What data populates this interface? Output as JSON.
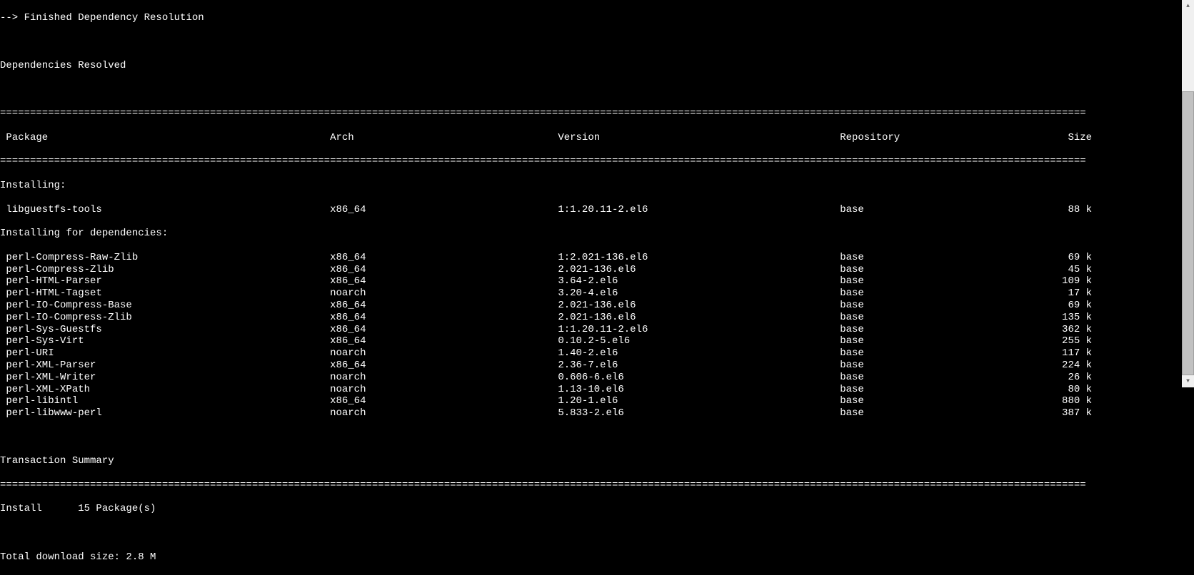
{
  "messages": {
    "finished_resolution": "--> Finished Dependency Resolution",
    "dependencies_resolved": "Dependencies Resolved",
    "installing": "Installing:",
    "installing_deps": "Installing for dependencies:",
    "transaction_summary": "Transaction Summary",
    "install_line": "Install      15 Package(s)",
    "total_download": "Total download size: 2.8 M"
  },
  "headers": {
    "package": " Package",
    "arch": "Arch",
    "version": "Version",
    "repository": "Repository",
    "size": "Size"
  },
  "main_package": {
    "name": " libguestfs-tools",
    "arch": "x86_64",
    "version": "1:1.20.11-2.el6",
    "repo": "base",
    "size": "88 k"
  },
  "dependencies": [
    {
      "name": " perl-Compress-Raw-Zlib",
      "arch": "x86_64",
      "version": "1:2.021-136.el6",
      "repo": "base",
      "size": "69 k"
    },
    {
      "name": " perl-Compress-Zlib",
      "arch": "x86_64",
      "version": "2.021-136.el6",
      "repo": "base",
      "size": "45 k"
    },
    {
      "name": " perl-HTML-Parser",
      "arch": "x86_64",
      "version": "3.64-2.el6",
      "repo": "base",
      "size": "109 k"
    },
    {
      "name": " perl-HTML-Tagset",
      "arch": "noarch",
      "version": "3.20-4.el6",
      "repo": "base",
      "size": "17 k"
    },
    {
      "name": " perl-IO-Compress-Base",
      "arch": "x86_64",
      "version": "2.021-136.el6",
      "repo": "base",
      "size": "69 k"
    },
    {
      "name": " perl-IO-Compress-Zlib",
      "arch": "x86_64",
      "version": "2.021-136.el6",
      "repo": "base",
      "size": "135 k"
    },
    {
      "name": " perl-Sys-Guestfs",
      "arch": "x86_64",
      "version": "1:1.20.11-2.el6",
      "repo": "base",
      "size": "362 k"
    },
    {
      "name": " perl-Sys-Virt",
      "arch": "x86_64",
      "version": "0.10.2-5.el6",
      "repo": "base",
      "size": "255 k"
    },
    {
      "name": " perl-URI",
      "arch": "noarch",
      "version": "1.40-2.el6",
      "repo": "base",
      "size": "117 k"
    },
    {
      "name": " perl-XML-Parser",
      "arch": "x86_64",
      "version": "2.36-7.el6",
      "repo": "base",
      "size": "224 k"
    },
    {
      "name": " perl-XML-Writer",
      "arch": "noarch",
      "version": "0.606-6.el6",
      "repo": "base",
      "size": "26 k"
    },
    {
      "name": " perl-XML-XPath",
      "arch": "noarch",
      "version": "1.13-10.el6",
      "repo": "base",
      "size": "80 k"
    },
    {
      "name": " perl-libintl",
      "arch": "x86_64",
      "version": "1.20-1.el6",
      "repo": "base",
      "size": "880 k"
    },
    {
      "name": " perl-libwww-perl",
      "arch": "noarch",
      "version": "5.833-2.el6",
      "repo": "base",
      "size": "387 k"
    }
  ],
  "columns": {
    "package_width": 55,
    "arch_width": 38,
    "version_width": 47,
    "repo_width": 36,
    "size_width": 6
  }
}
